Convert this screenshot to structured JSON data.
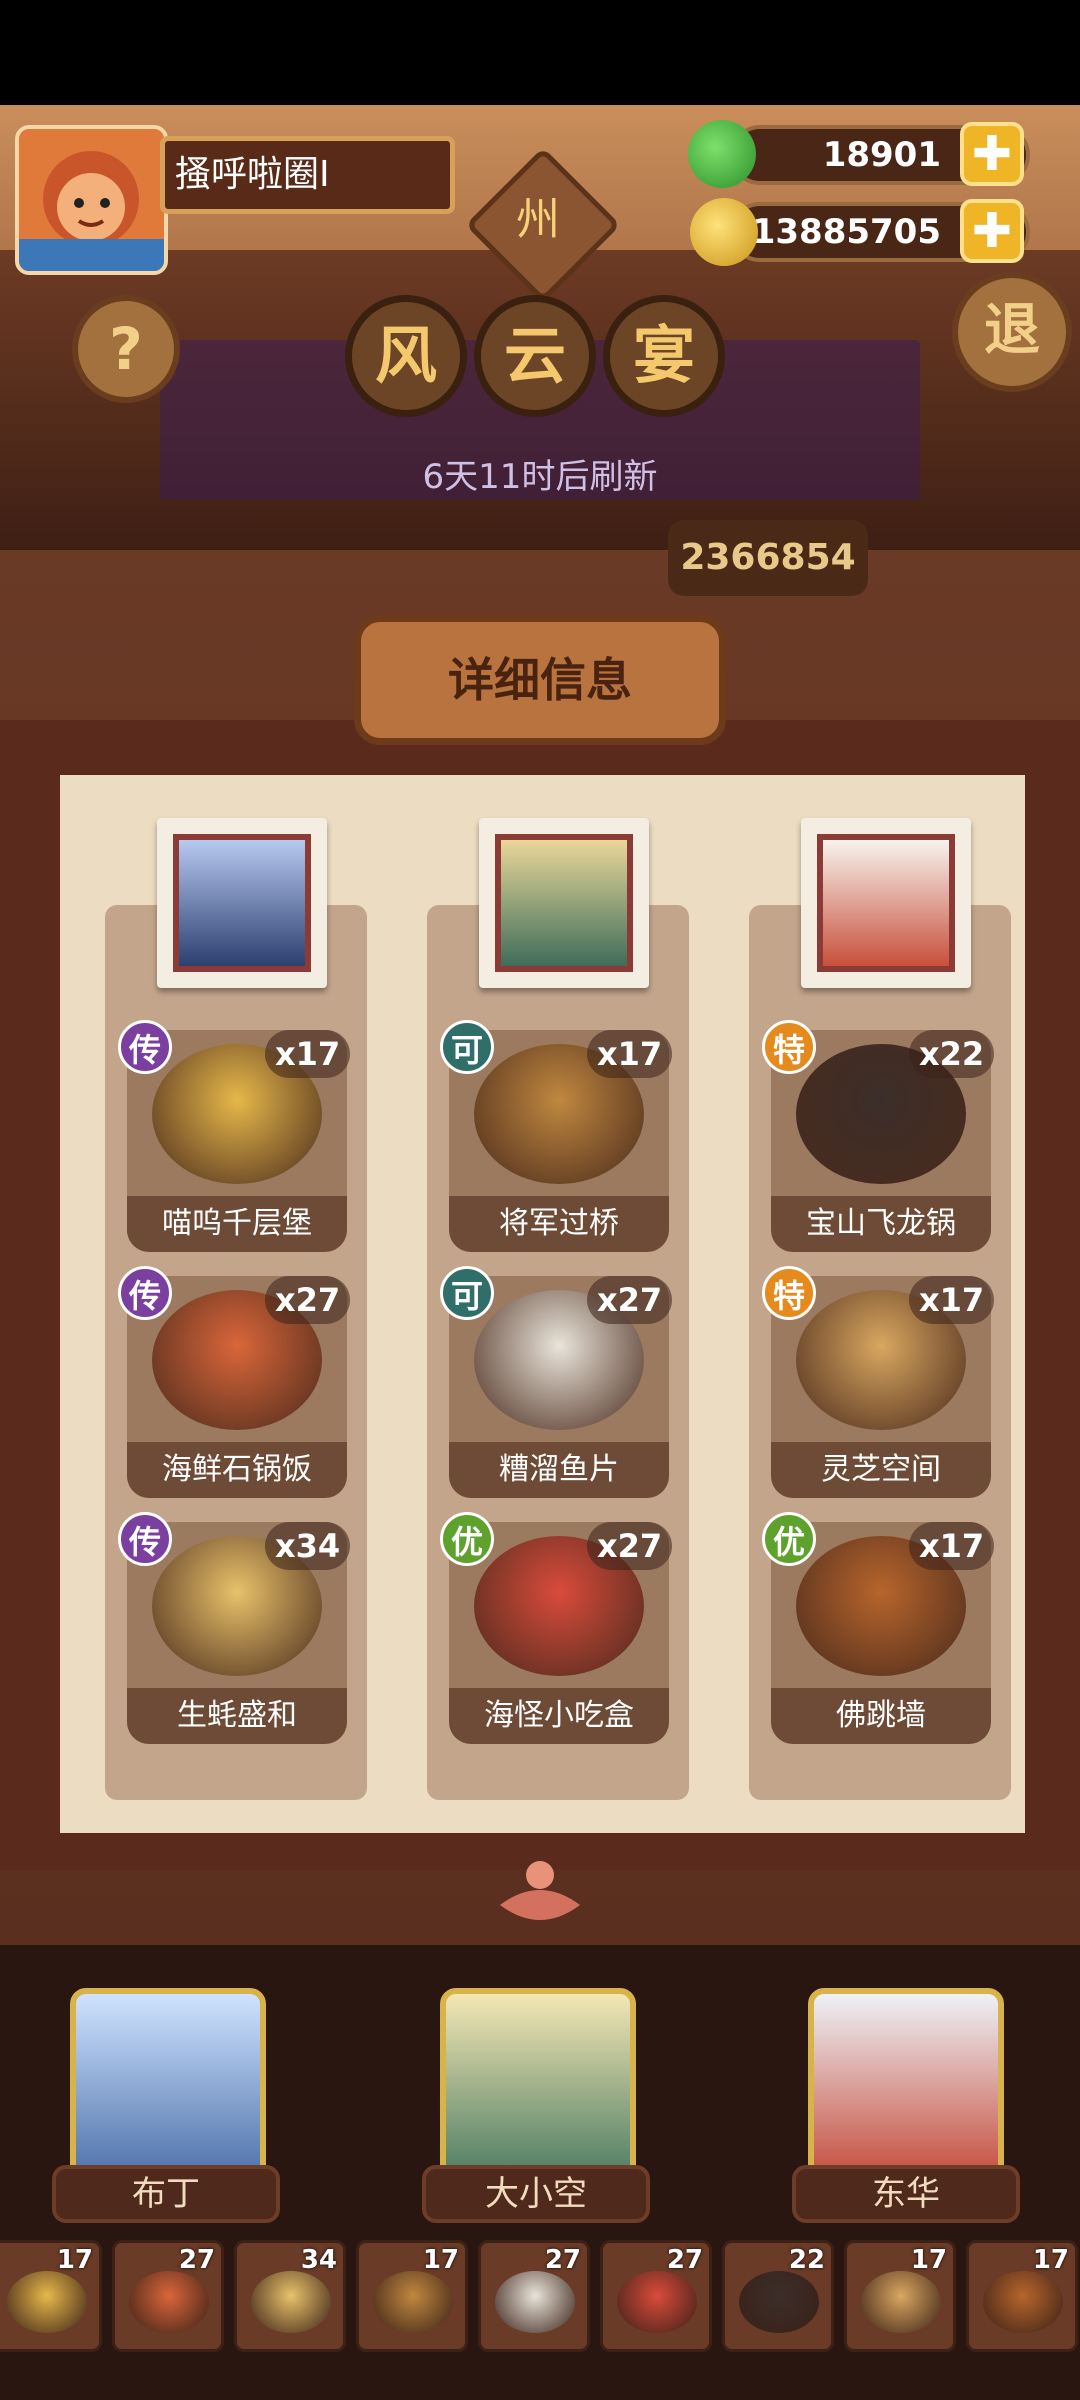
{
  "player": {
    "name": "搔呼啦圈I"
  },
  "region_badge": "州",
  "resources": {
    "jade": "18901",
    "coins": "13885705",
    "add_symbol": "✚"
  },
  "buttons": {
    "help": "?",
    "exit": "退"
  },
  "banquet_title": [
    "风",
    "云",
    "宴"
  ],
  "refresh_text": "6天11时后刷新",
  "score": "2366854",
  "detail_tab": "详细信息",
  "rarity_colors": {
    "传": "#7b3fa0",
    "可": "#2f6e69",
    "特": "#e58a1c",
    "优": "#5fa12d"
  },
  "columns": [
    {
      "dishes": [
        {
          "rarity": "传",
          "qty": "x17",
          "name": "喵呜千层堡",
          "color": "#e6b84a"
        },
        {
          "rarity": "传",
          "qty": "x27",
          "name": "海鲜石锅饭",
          "color": "#d9663a"
        },
        {
          "rarity": "传",
          "qty": "x34",
          "name": "生蚝盛和",
          "color": "#e8c26a"
        }
      ]
    },
    {
      "dishes": [
        {
          "rarity": "可",
          "qty": "x17",
          "name": "将军过桥",
          "color": "#c0883f"
        },
        {
          "rarity": "可",
          "qty": "x27",
          "name": "糟溜鱼片",
          "color": "#e9e4da"
        },
        {
          "rarity": "优",
          "qty": "x27",
          "name": "海怪小吃盒",
          "color": "#d94b3b"
        }
      ]
    },
    {
      "dishes": [
        {
          "rarity": "特",
          "qty": "x22",
          "name": "宝山飞龙锅",
          "color": "#3b2e2a"
        },
        {
          "rarity": "特",
          "qty": "x17",
          "name": "灵芝空间",
          "color": "#d9a760"
        },
        {
          "rarity": "优",
          "qty": "x17",
          "name": "佛跳墙",
          "color": "#b7652c"
        }
      ]
    }
  ],
  "characters": [
    {
      "name": "布丁"
    },
    {
      "name": "大小空"
    },
    {
      "name": "东华"
    }
  ],
  "tiles": [
    "17",
    "27",
    "34",
    "17",
    "27",
    "27",
    "22",
    "17",
    "17"
  ]
}
